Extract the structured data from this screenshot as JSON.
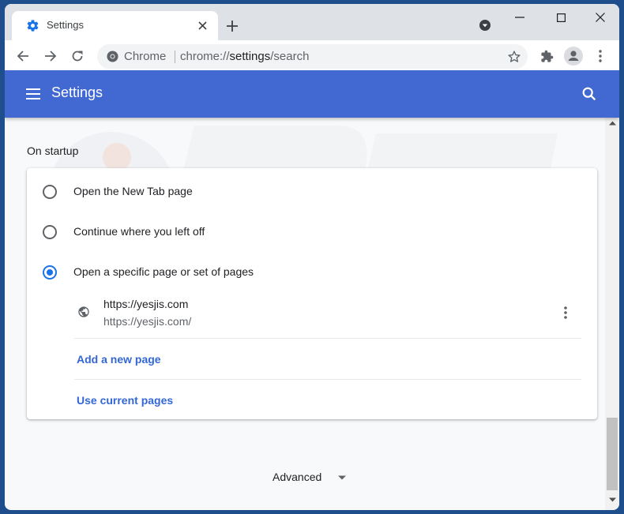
{
  "browser": {
    "tab": {
      "title": "Settings",
      "icon": "gear-icon"
    },
    "new_tab_icon": "plus-icon",
    "tab_search_icon": "tab-search-icon",
    "window_controls": [
      "minimize",
      "maximize",
      "close"
    ],
    "nav": {
      "back_icon": "arrow-left-icon",
      "forward_icon": "arrow-right-icon",
      "reload_icon": "reload-icon"
    },
    "omnibox": {
      "chip": "Chrome",
      "url_prefix": "chrome://",
      "url_host": "settings",
      "url_path": "/search"
    },
    "toolbar_icons": [
      "star-icon",
      "extensions-icon",
      "profile-icon",
      "more-vert-icon"
    ]
  },
  "settings": {
    "header_title": "Settings",
    "section_title": "On startup",
    "options": [
      {
        "label": "Open the New Tab page",
        "checked": false
      },
      {
        "label": "Continue where you left off",
        "checked": false
      },
      {
        "label": "Open a specific page or set of pages",
        "checked": true
      }
    ],
    "startup_pages": [
      {
        "title": "https://yesjis.com",
        "url": "https://yesjis.com/"
      }
    ],
    "add_page_label": "Add a new page",
    "use_current_label": "Use current pages",
    "advanced_label": "Advanced"
  },
  "colors": {
    "header_blue": "#4169d1",
    "link_blue": "#3367d6",
    "radio_blue": "#1a73e8",
    "frame": "#1f4e8c"
  }
}
